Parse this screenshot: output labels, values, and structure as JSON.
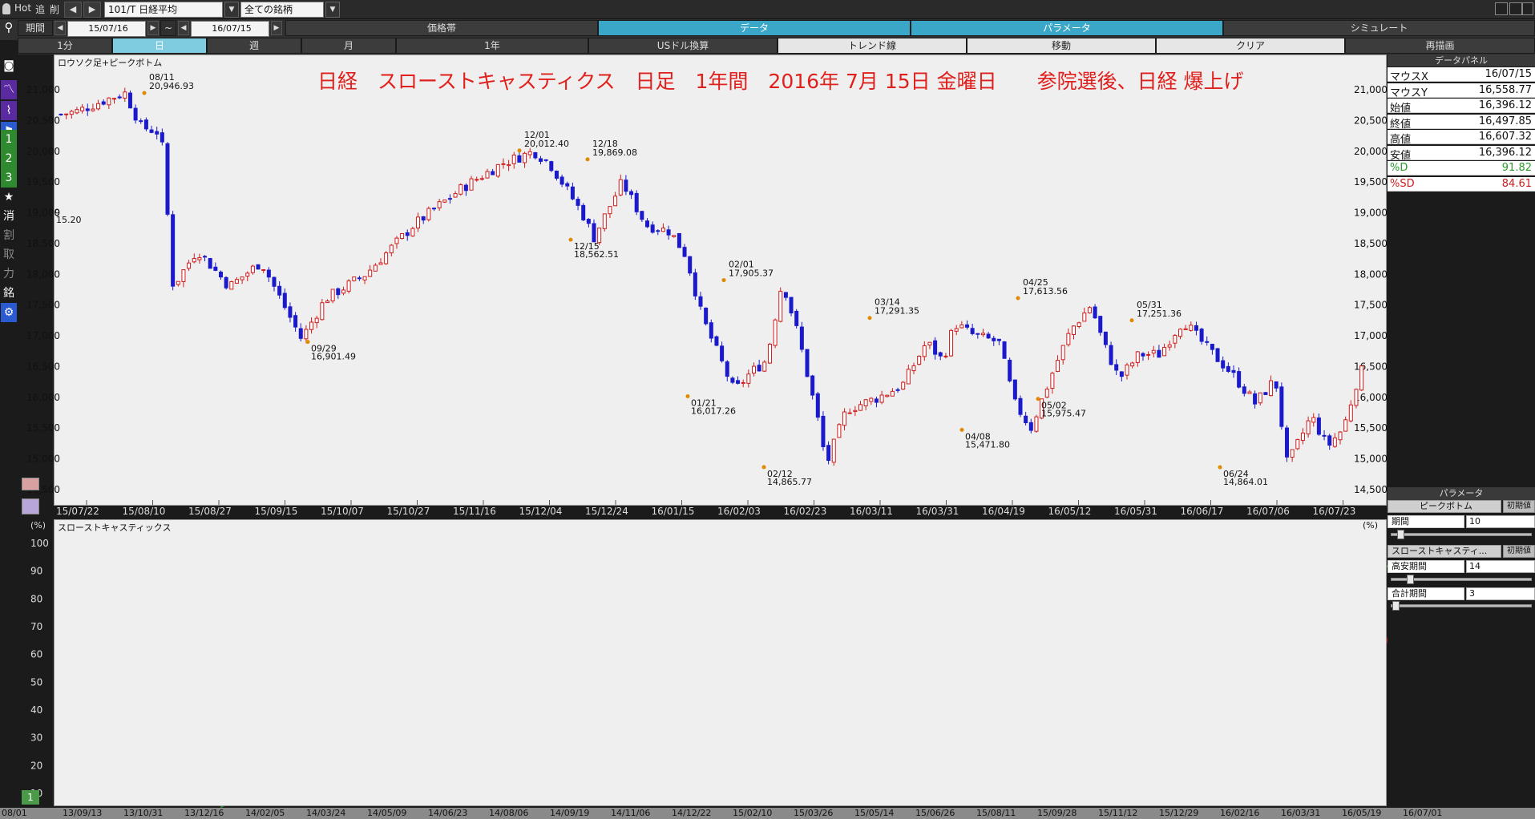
{
  "topbar": {
    "hot": "Hot",
    "add": "追",
    "del": "削",
    "symbol": "101/T 日経平均",
    "universe": "全ての銘柄"
  },
  "period_row": {
    "label": "期間",
    "start": "15/07/16",
    "tilde": "~",
    "end": "16/07/15",
    "tabs": [
      "価格帯",
      "データ",
      "パラメータ",
      "シミュレート"
    ]
  },
  "interval_row": {
    "intervals": [
      "1分",
      "日",
      "週",
      "月",
      "1年"
    ],
    "tools": [
      "USドル換算",
      "トレンド線",
      "移動",
      "クリア",
      "再描画"
    ]
  },
  "left_toolbar": [
    "1",
    "2",
    "3",
    "消",
    "割",
    "取",
    "力",
    "銘"
  ],
  "main_chart": {
    "panel_title": "ロウソク足+ピークボトム",
    "headline": "日経　スローストキャスティクス　日足　1年間　2016年 7月 15日 金曜日　　参院選後、日経 爆上げ",
    "edge_labels": [
      "9",
      "15.20"
    ],
    "y_ticks": [
      "21,000",
      "20,500",
      "20,000",
      "19,500",
      "19,000",
      "18,500",
      "18,000",
      "17,500",
      "17,000",
      "16,500",
      "16,000",
      "15,500",
      "15,000",
      "14,500"
    ],
    "x_ticks": [
      "15/07/22",
      "15/08/10",
      "15/08/27",
      "15/09/15",
      "15/10/07",
      "15/10/27",
      "15/11/16",
      "15/12/04",
      "15/12/24",
      "16/01/15",
      "16/02/03",
      "16/02/23",
      "16/03/11",
      "16/03/31",
      "16/04/19",
      "16/05/12",
      "16/05/31",
      "16/06/17",
      "16/07/06",
      "16/07/23"
    ],
    "peaks": [
      {
        "date": "08/11",
        "price": "20,946.93"
      },
      {
        "date": "12/01",
        "price": "20,012.40"
      },
      {
        "date": "12/18",
        "price": "19,869.08"
      },
      {
        "date": "02/01",
        "price": "17,905.37"
      },
      {
        "date": "03/14",
        "price": "17,291.35"
      },
      {
        "date": "04/25",
        "price": "17,613.56"
      },
      {
        "date": "05/31",
        "price": "17,251.36"
      }
    ],
    "bottoms": [
      {
        "date": "09/29",
        "price": "16,901.49"
      },
      {
        "date": "12/15",
        "price": "18,562.51"
      },
      {
        "date": "01/21",
        "price": "16,017.26"
      },
      {
        "date": "02/12",
        "price": "14,865.77"
      },
      {
        "date": "04/08",
        "price": "15,471.80"
      },
      {
        "date": "05/02",
        "price": "15,975.47"
      },
      {
        "date": "06/24",
        "price": "14,864.01"
      }
    ]
  },
  "stoch_chart": {
    "panel_title": "スローストキャスティックス",
    "unit": "(%)",
    "y_ticks": [
      "100",
      "90",
      "80",
      "70",
      "60",
      "50",
      "40",
      "30",
      "20",
      "10"
    ],
    "x_ticks": [
      "15/07/22",
      "15/08/10",
      "15/08/27",
      "15/09/15",
      "15/10/07",
      "15/10/27",
      "15/11/16",
      "15/12/04",
      "15/12/24",
      "16/01/15",
      "16/02/03",
      "16/02/23",
      "16/03/11",
      "16/03/31",
      "16/04/19",
      "16/05/12",
      "16/05/31",
      "16/06/17",
      "16/07/06",
      "16/07/23"
    ],
    "page_badge": "1"
  },
  "data_panel": {
    "title": "データパネル",
    "rows": [
      {
        "k": "マウスX",
        "v": "16/07/15",
        "color": "#111111"
      },
      {
        "k": "マウスY",
        "v": "16,558.77",
        "color": "#111111"
      },
      {
        "k": "始値",
        "v": "16,396.12",
        "color": "#111111"
      },
      {
        "k": "終値",
        "v": "16,497.85",
        "color": "#111111"
      },
      {
        "k": "高値",
        "v": "16,607.32",
        "color": "#111111"
      },
      {
        "k": "安値",
        "v": "16,396.12",
        "color": "#111111"
      },
      {
        "k": "%D",
        "v": "91.82",
        "color": "#2a9a2a"
      },
      {
        "k": "%SD",
        "v": "84.61",
        "color": "#d01c1c"
      }
    ]
  },
  "param_panel": {
    "title": "パラメータ",
    "peak": {
      "name": "ピークボトム",
      "reset": "初期値",
      "period_label": "期間",
      "period": "10"
    },
    "stoch": {
      "name": "スローストキャスティ...",
      "reset": "初期値",
      "hl_label": "高安期間",
      "hl": "14",
      "sum_label": "合計期間",
      "sum": "3"
    }
  },
  "bottom_dates": [
    "08/01",
    "13/09/13",
    "13/10/31",
    "13/12/16",
    "14/02/05",
    "14/03/24",
    "14/05/09",
    "14/06/23",
    "14/08/06",
    "14/09/19",
    "14/11/06",
    "14/12/22",
    "15/02/10",
    "15/03/26",
    "15/05/14",
    "15/06/26",
    "15/08/11",
    "15/09/28",
    "15/11/12",
    "15/12/29",
    "16/02/16",
    "16/03/31",
    "16/05/19",
    "16/07/01"
  ],
  "colors": {
    "up": "#d01c1c",
    "down": "#1a1acc",
    "pct_d": "#2a9a2a",
    "pct_sd": "#d01c1c",
    "accent": "#7fcbe0",
    "headline": "#e0201c"
  }
}
